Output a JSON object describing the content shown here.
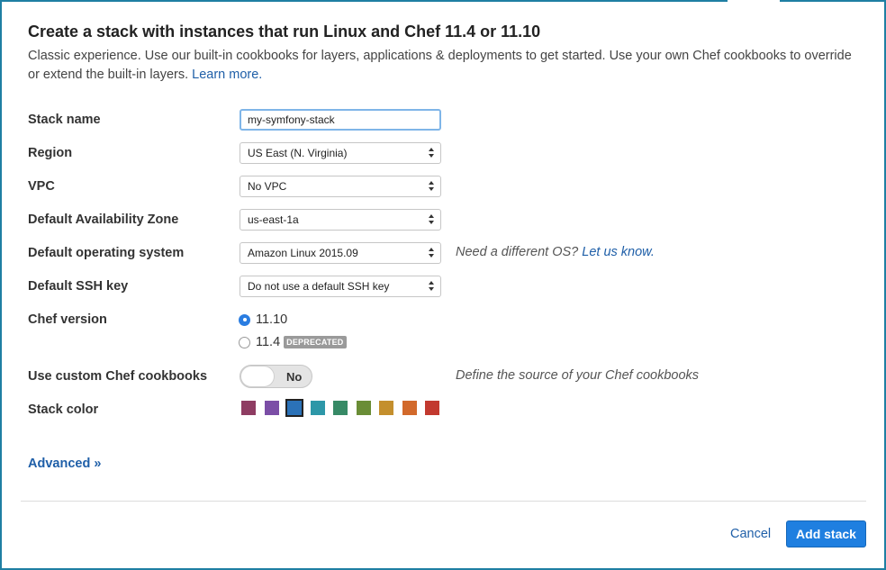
{
  "header": {
    "title": "Create a stack with instances that run Linux and Chef 11.4 or 11.10",
    "description": "Classic experience. Use our built-in cookbooks for layers, applications & deployments to get started. Use your own Chef cookbooks to override or extend the built-in layers.",
    "learn_more": "Learn more."
  },
  "form": {
    "stack_name": {
      "label": "Stack name",
      "value": "my-symfony-stack"
    },
    "region": {
      "label": "Region",
      "value": "US East (N. Virginia)"
    },
    "vpc": {
      "label": "VPC",
      "value": "No VPC"
    },
    "availability_zone": {
      "label": "Default Availability Zone",
      "value": "us-east-1a"
    },
    "os": {
      "label": "Default operating system",
      "value": "Amazon Linux 2015.09",
      "hint": "Need a different OS?",
      "hint_link": "Let us know."
    },
    "ssh_key": {
      "label": "Default SSH key",
      "value": "Do not use a default SSH key"
    },
    "chef_version": {
      "label": "Chef version",
      "options": [
        {
          "label": "11.10",
          "checked": true
        },
        {
          "label": "11.4",
          "checked": false,
          "badge": "DEPRECATED"
        }
      ]
    },
    "custom_cookbooks": {
      "label": "Use custom Chef cookbooks",
      "toggle_state": "No",
      "hint": "Define the source of your Chef cookbooks"
    },
    "stack_color": {
      "label": "Stack color",
      "colors": [
        "#8e3c62",
        "#7b4ea6",
        "#2b72b8",
        "#2d97a8",
        "#378a66",
        "#6a8d36",
        "#c48f2d",
        "#d2692b",
        "#c2392f"
      ],
      "selected_index": 2
    }
  },
  "advanced": "Advanced »",
  "footer": {
    "cancel": "Cancel",
    "submit": "Add stack"
  }
}
